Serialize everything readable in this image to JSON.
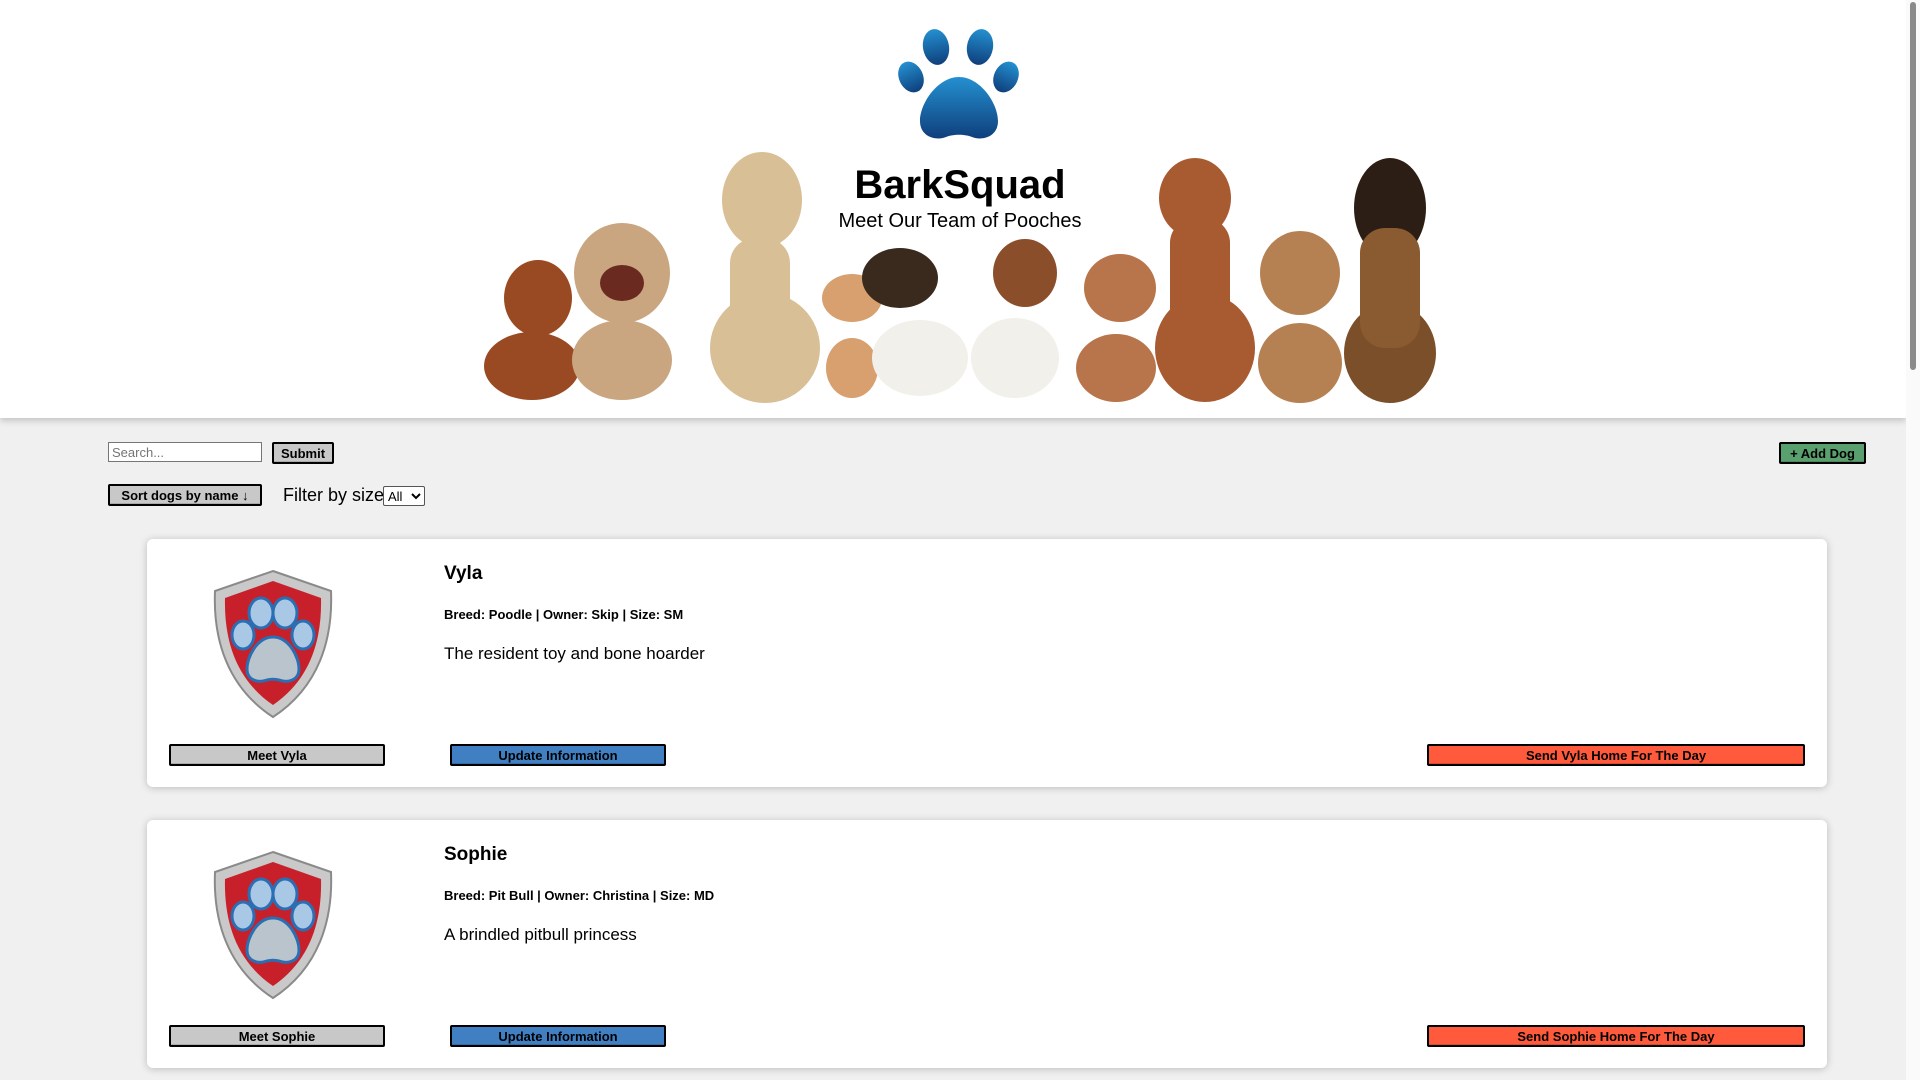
{
  "header": {
    "title": "BarkSquad",
    "subtitle": "Meet Our Team of Pooches"
  },
  "toolbar": {
    "search_placeholder": "Search...",
    "submit_label": "Submit",
    "add_label": "+ Add Dog",
    "sort_label": "Sort dogs by name ↓",
    "filter_label": "Filter by size:",
    "filter_selected": "All"
  },
  "dogs": [
    {
      "name": "Vyla",
      "meta": "Breed: Poodle | Owner: Skip | Size: SM",
      "description": "The resident toy and bone hoarder",
      "meet_label": "Meet Vyla",
      "update_label": "Update Information",
      "send_label": "Send Vyla Home For The Day"
    },
    {
      "name": "Sophie",
      "meta": "Breed: Pit Bull | Owner: Christina | Size: MD",
      "description": "A brindled pitbull princess",
      "meet_label": "Meet Sophie",
      "update_label": "Update Information",
      "send_label": "Send Sophie Home For The Day"
    }
  ],
  "colors": {
    "paw_gradient_top": "#1e7fc1",
    "paw_gradient_bottom": "#12437f",
    "add_button": "#5aa06e",
    "update_button": "#3f7fc2",
    "send_button": "#ff5a3c",
    "neutral_button": "#c8c8c8",
    "badge_red": "#c8202a"
  },
  "icons": {
    "logo": "paw-icon",
    "card_badge": "paw-shield-icon"
  }
}
